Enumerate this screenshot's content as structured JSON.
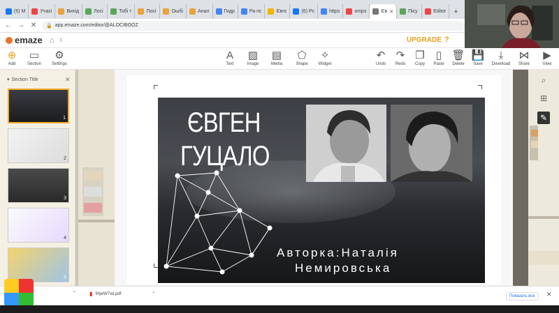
{
  "browser": {
    "tabs": [
      {
        "label": "(6) M",
        "fav_color": "#1877f2"
      },
      {
        "label": "Учасі",
        "fav_color": "#e44"
      },
      {
        "label": "Вихід",
        "fav_color": "#e8a33a"
      },
      {
        "label": "Лосі",
        "fav_color": "#5aa55a"
      },
      {
        "label": "Тобі т",
        "fav_color": "#5aa55a"
      },
      {
        "label": "Посі",
        "fav_color": "#e8a33a"
      },
      {
        "label": "Ошбі",
        "fav_color": "#e8a33a"
      },
      {
        "label": "Анал",
        "fav_color": "#e8a33a"
      },
      {
        "label": "Гидр",
        "fav_color": "#4285f4"
      },
      {
        "label": "Ра пс",
        "fav_color": "#4285f4"
      },
      {
        "label": "Євгє",
        "fav_color": "#f4b400"
      },
      {
        "label": "(6) Рс",
        "fav_color": "#1877f2"
      },
      {
        "label": "https",
        "fav_color": "#4285f4"
      },
      {
        "label": "omps",
        "fav_color": "#e44"
      },
      {
        "label": "Єв",
        "fav_color": "#777",
        "active": true
      },
      {
        "label": "Пісу",
        "fav_color": "#5aa55a"
      },
      {
        "label": "Editor",
        "fav_color": "#e44"
      }
    ],
    "url": "app.emaze.com/editor/@ALOCIBOOZ"
  },
  "app": {
    "logo": "emaze",
    "upgrade_label": "UPGRADE",
    "help_label": "?"
  },
  "toolbar": {
    "left": [
      {
        "label": "Add",
        "icon": "plus-circle-icon",
        "glyph": "⊕"
      },
      {
        "label": "Section",
        "icon": "folder-icon",
        "glyph": "▭"
      },
      {
        "label": "Settings",
        "icon": "gear-icon",
        "glyph": "⚙"
      }
    ],
    "center": [
      {
        "label": "Text",
        "icon": "text-icon",
        "glyph": "A"
      },
      {
        "label": "Image",
        "icon": "image-icon",
        "glyph": "▨"
      },
      {
        "label": "Media",
        "icon": "media-icon",
        "glyph": "▤"
      },
      {
        "label": "Shape",
        "icon": "shape-icon",
        "glyph": "⬠"
      },
      {
        "label": "Widget",
        "icon": "widget-icon",
        "glyph": "✧"
      }
    ],
    "right": [
      {
        "label": "Undo",
        "icon": "undo-icon",
        "glyph": "↶"
      },
      {
        "label": "Redo",
        "icon": "redo-icon",
        "glyph": "↷"
      },
      {
        "label": "Copy",
        "icon": "copy-icon",
        "glyph": "❐"
      },
      {
        "label": "Paste",
        "icon": "paste-icon",
        "glyph": "▯"
      },
      {
        "label": "Delete",
        "icon": "trash-icon",
        "glyph": "🗑"
      },
      {
        "label": "Save",
        "icon": "save-icon",
        "glyph": "💾"
      },
      {
        "label": "Download",
        "icon": "download-icon",
        "glyph": "⤓"
      },
      {
        "label": "Share",
        "icon": "share-icon",
        "glyph": "⋈"
      },
      {
        "label": "View",
        "icon": "view-icon",
        "glyph": "▶"
      }
    ]
  },
  "sidebar": {
    "section_title": "Section Title",
    "slides": [
      {
        "number": "1",
        "selected": true
      },
      {
        "number": "2"
      },
      {
        "number": "3"
      },
      {
        "number": "4"
      },
      {
        "number": "5"
      }
    ]
  },
  "slide": {
    "title_line1": "ЄВГЕН",
    "title_line2": "ГУЦАЛО",
    "author_line1": "Авторка:Наталія",
    "author_line2": "Немировська"
  },
  "downloads": {
    "item1": "",
    "item2": "fHjwW7xd.pdf",
    "show_all": "Показать все"
  }
}
